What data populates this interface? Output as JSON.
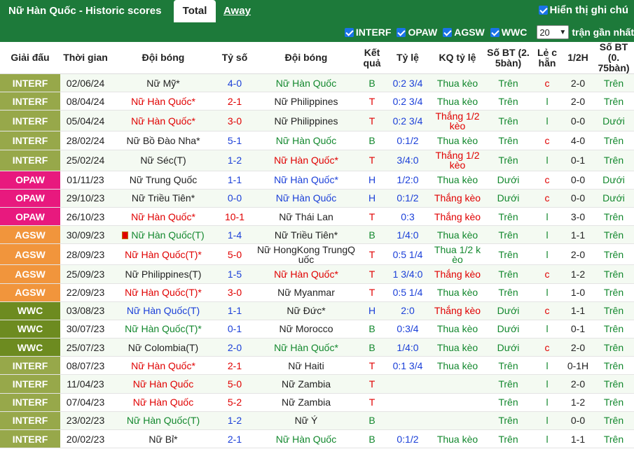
{
  "header": {
    "title": "Nữ Hàn Quốc - Historic scores",
    "tab_total": "Total",
    "tab_away": "Away",
    "show_label": "Hiển thị ghi chú"
  },
  "filters": {
    "options": [
      "INTERF",
      "OPAW",
      "AGSW",
      "WWC"
    ],
    "count": "20",
    "recent_label": "trận gần nhất"
  },
  "columns": [
    "Giải đấu",
    "Thời gian",
    "Đội bóng",
    "Tỷ số",
    "Đội bóng",
    "Kết quả",
    "Tỷ lệ",
    "KQ tỷ lệ",
    "Số BT (2. 5bàn)",
    "Lẻ c hẵn",
    "1/2H",
    "Số BT (0. 75bàn)"
  ],
  "colors": {
    "INTERF": "#97a84a",
    "OPAW": "#e8197e",
    "AGSW": "#f1953c",
    "WWC": "#6d8b20",
    "header_green": "#1d7a3a"
  },
  "rows": [
    {
      "comp": "INTERF",
      "date": "02/06/24",
      "home": "Nữ Mỹ*",
      "hc": "dark",
      "score": "4-0",
      "away": "Nữ Hàn Quốc",
      "ac": "green",
      "res": "B",
      "odds": "0:2 3/4",
      "kq": "Thua kèo",
      "ou": "Trên",
      "oe": "c",
      "half": "2-0",
      "ou2": "Trên"
    },
    {
      "comp": "INTERF",
      "date": "08/04/24",
      "home": "Nữ Hàn Quốc*",
      "hc": "red",
      "score": "2-1",
      "away": "Nữ Philippines",
      "ac": "dark",
      "res": "T",
      "odds": "0:2 3/4",
      "kq": "Thua kèo",
      "ou": "Trên",
      "oe": "l",
      "half": "2-0",
      "ou2": "Trên"
    },
    {
      "comp": "INTERF",
      "date": "05/04/24",
      "home": "Nữ Hàn Quốc*",
      "hc": "red",
      "score": "3-0",
      "away": "Nữ Philippines",
      "ac": "dark",
      "res": "T",
      "odds": "0:2 3/4",
      "kq": "Thắng 1/2 kèo",
      "ou": "Trên",
      "oe": "l",
      "half": "0-0",
      "ou2": "Dưới"
    },
    {
      "comp": "INTERF",
      "date": "28/02/24",
      "home": "Nữ Bồ Đào Nha*",
      "hc": "dark",
      "score": "5-1",
      "away": "Nữ Hàn Quốc",
      "ac": "green",
      "res": "B",
      "odds": "0:1/2",
      "kq": "Thua kèo",
      "ou": "Trên",
      "oe": "c",
      "half": "4-0",
      "ou2": "Trên"
    },
    {
      "comp": "INTERF",
      "date": "25/02/24",
      "home": "Nữ Séc(T)",
      "hc": "dark",
      "score": "1-2",
      "away": "Nữ Hàn Quốc*",
      "ac": "red",
      "res": "T",
      "odds": "3/4:0",
      "kq": "Thắng 1/2 kèo",
      "ou": "Trên",
      "oe": "l",
      "half": "0-1",
      "ou2": "Trên"
    },
    {
      "comp": "OPAW",
      "date": "01/11/23",
      "home": "Nữ Trung Quốc",
      "hc": "dark",
      "score": "1-1",
      "away": "Nữ Hàn Quốc*",
      "ac": "blue",
      "res": "H",
      "odds": "1/2:0",
      "kq": "Thua kèo",
      "ou": "Dưới",
      "oe": "c",
      "half": "0-0",
      "ou2": "Dưới"
    },
    {
      "comp": "OPAW",
      "date": "29/10/23",
      "home": "Nữ Triều Tiên*",
      "hc": "dark",
      "score": "0-0",
      "away": "Nữ Hàn Quốc",
      "ac": "blue",
      "res": "H",
      "odds": "0:1/2",
      "kq": "Thắng kèo",
      "ou": "Dưới",
      "oe": "c",
      "half": "0-0",
      "ou2": "Dưới"
    },
    {
      "comp": "OPAW",
      "date": "26/10/23",
      "home": "Nữ Hàn Quốc*",
      "hc": "red",
      "score": "10-1",
      "away": "Nữ Thái Lan",
      "ac": "dark",
      "res": "T",
      "odds": "0:3",
      "kq": "Thắng kèo",
      "ou": "Trên",
      "oe": "l",
      "half": "3-0",
      "ou2": "Trên"
    },
    {
      "comp": "AGSW",
      "date": "30/09/23",
      "home": "Nữ Hàn Quốc(T)",
      "hc": "green",
      "flag": true,
      "score": "1-4",
      "away": "Nữ Triều Tiên*",
      "ac": "dark",
      "res": "B",
      "odds": "1/4:0",
      "kq": "Thua kèo",
      "ou": "Trên",
      "oe": "l",
      "half": "1-1",
      "ou2": "Trên"
    },
    {
      "comp": "AGSW",
      "date": "28/09/23",
      "home": "Nữ Hàn Quốc(T)*",
      "hc": "red",
      "score": "5-0",
      "away": "Nữ HongKong TrungQ uốc",
      "ac": "dark",
      "res": "T",
      "odds": "0:5 1/4",
      "kq": "Thua 1/2 k èo",
      "ou": "Trên",
      "oe": "l",
      "half": "2-0",
      "ou2": "Trên"
    },
    {
      "comp": "AGSW",
      "date": "25/09/23",
      "home": "Nữ Philippines(T)",
      "hc": "dark",
      "score": "1-5",
      "away": "Nữ Hàn Quốc*",
      "ac": "red",
      "res": "T",
      "odds": "1 3/4:0",
      "kq": "Thắng kèo",
      "ou": "Trên",
      "oe": "c",
      "half": "1-2",
      "ou2": "Trên"
    },
    {
      "comp": "AGSW",
      "date": "22/09/23",
      "home": "Nữ Hàn Quốc(T)*",
      "hc": "red",
      "score": "3-0",
      "away": "Nữ Myanmar",
      "ac": "dark",
      "res": "T",
      "odds": "0:5 1/4",
      "kq": "Thua kèo",
      "ou": "Trên",
      "oe": "l",
      "half": "1-0",
      "ou2": "Trên"
    },
    {
      "comp": "WWC",
      "date": "03/08/23",
      "home": "Nữ Hàn Quốc(T)",
      "hc": "blue",
      "score": "1-1",
      "away": "Nữ Đức*",
      "ac": "dark",
      "res": "H",
      "odds": "2:0",
      "kq": "Thắng kèo",
      "ou": "Dưới",
      "oe": "c",
      "half": "1-1",
      "ou2": "Trên"
    },
    {
      "comp": "WWC",
      "date": "30/07/23",
      "home": "Nữ Hàn Quốc(T)*",
      "hc": "green",
      "score": "0-1",
      "away": "Nữ Morocco",
      "ac": "dark",
      "res": "B",
      "odds": "0:3/4",
      "kq": "Thua kèo",
      "ou": "Dưới",
      "oe": "l",
      "half": "0-1",
      "ou2": "Trên"
    },
    {
      "comp": "WWC",
      "date": "25/07/23",
      "home": "Nữ Colombia(T)",
      "hc": "dark",
      "score": "2-0",
      "away": "Nữ Hàn Quốc*",
      "ac": "green",
      "res": "B",
      "odds": "1/4:0",
      "kq": "Thua kèo",
      "ou": "Dưới",
      "oe": "c",
      "half": "2-0",
      "ou2": "Trên"
    },
    {
      "comp": "INTERF",
      "date": "08/07/23",
      "home": "Nữ Hàn Quốc*",
      "hc": "red",
      "score": "2-1",
      "away": "Nữ Haiti",
      "ac": "dark",
      "res": "T",
      "odds": "0:1 3/4",
      "kq": "Thua kèo",
      "ou": "Trên",
      "oe": "l",
      "half": "0-1H",
      "ou2": "Trên"
    },
    {
      "comp": "INTERF",
      "date": "11/04/23",
      "home": "Nữ Hàn Quốc",
      "hc": "red",
      "score": "5-0",
      "away": "Nữ Zambia",
      "ac": "dark",
      "res": "T",
      "odds": "",
      "kq": "",
      "ou": "Trên",
      "oe": "l",
      "half": "2-0",
      "ou2": "Trên"
    },
    {
      "comp": "INTERF",
      "date": "07/04/23",
      "home": "Nữ Hàn Quốc",
      "hc": "red",
      "score": "5-2",
      "away": "Nữ Zambia",
      "ac": "dark",
      "res": "T",
      "odds": "",
      "kq": "",
      "ou": "Trên",
      "oe": "l",
      "half": "1-2",
      "ou2": "Trên"
    },
    {
      "comp": "INTERF",
      "date": "23/02/23",
      "home": "Nữ Hàn Quốc(T)",
      "hc": "green",
      "score": "1-2",
      "away": "Nữ Ý",
      "ac": "dark",
      "res": "B",
      "odds": "",
      "kq": "",
      "ou": "Trên",
      "oe": "l",
      "half": "0-0",
      "ou2": "Trên"
    },
    {
      "comp": "INTERF",
      "date": "20/02/23",
      "home": "Nữ Bỉ*",
      "hc": "dark",
      "score": "2-1",
      "away": "Nữ Hàn Quốc",
      "ac": "green",
      "res": "B",
      "odds": "0:1/2",
      "kq": "Thua kèo",
      "ou": "Trên",
      "oe": "l",
      "half": "1-1",
      "ou2": "Trên"
    }
  ]
}
